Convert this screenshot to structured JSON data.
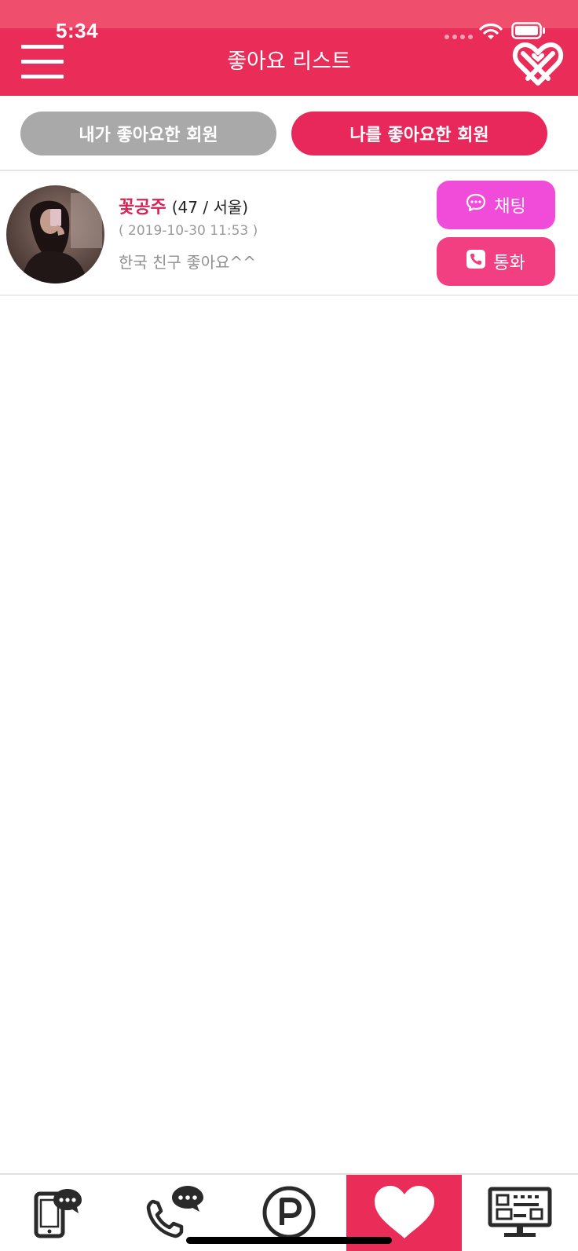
{
  "status_bar": {
    "time": "5:34"
  },
  "header": {
    "title": "좋아요 리스트"
  },
  "tabs": {
    "left_label": "내가 좋아요한 회원",
    "right_label": "나를 좋아요한 회원",
    "active": "right"
  },
  "likes": [
    {
      "name": "꽃공주",
      "age_region": "(47 / 서울)",
      "date": "( 2019-10-30 11:53 )",
      "message": "한국 친구 좋아요^^",
      "chat_label": "채팅",
      "call_label": "통화"
    }
  ],
  "bottom_nav": {
    "items": [
      "message-tablet-icon",
      "phone-chat-icon",
      "point-icon",
      "heart-icon",
      "monitor-icon"
    ],
    "active_index": 3
  },
  "colors": {
    "header": "#ea2c59",
    "tab_inactive": "#a9a9a9",
    "tab_active": "#e8285a",
    "chat_button": "#f14bd9",
    "call_button": "#f23f82",
    "name_text": "#d72355"
  }
}
